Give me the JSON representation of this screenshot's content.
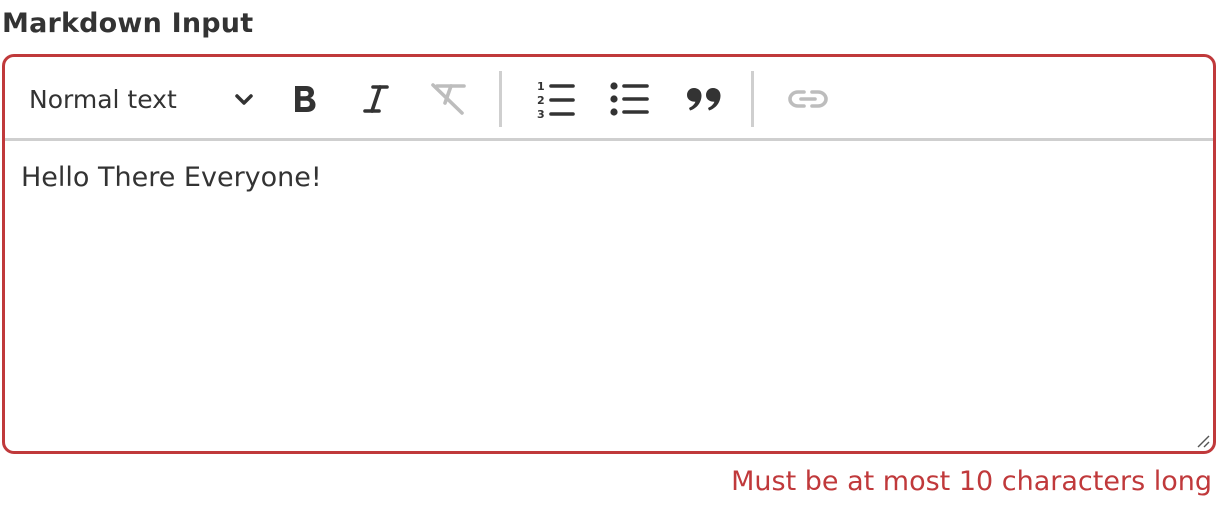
{
  "field": {
    "label": "Markdown Input",
    "error": "Must be at most 10 characters long",
    "error_color": "#c0393b"
  },
  "toolbar": {
    "format_select": {
      "selected": "Normal text",
      "icon": "chevron-down-icon"
    },
    "buttons": [
      {
        "name": "bold",
        "icon": "bold-icon",
        "enabled": true
      },
      {
        "name": "italic",
        "icon": "italic-icon",
        "enabled": true
      },
      {
        "name": "clear-formatting",
        "icon": "clear-formatting-icon",
        "enabled": false
      },
      {
        "name": "ordered-list",
        "icon": "ordered-list-icon",
        "enabled": true
      },
      {
        "name": "bullet-list",
        "icon": "bullet-list-icon",
        "enabled": true
      },
      {
        "name": "blockquote",
        "icon": "quote-icon",
        "enabled": true
      },
      {
        "name": "link",
        "icon": "link-icon",
        "enabled": false
      }
    ]
  },
  "editor": {
    "content": "Hello There Everyone!"
  },
  "colors": {
    "text": "#333333",
    "disabled_icon": "#bdbdbd",
    "divider": "#cfcfcf",
    "error_border": "#c0393b"
  }
}
